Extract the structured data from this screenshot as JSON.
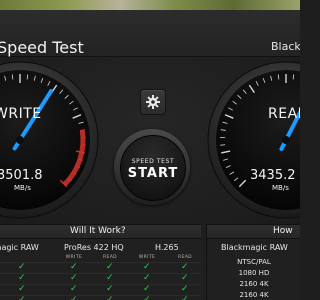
{
  "window": {
    "title": "Speed Test",
    "brand": "Blackmagic"
  },
  "gauges": {
    "write": {
      "label": "WRITE",
      "value": "3501.8",
      "unit": "MB/s",
      "fraction": 0.62
    },
    "read": {
      "label": "READ",
      "value": "3435.2",
      "unit": "MB/s",
      "fraction": 0.6
    }
  },
  "controls": {
    "settings_icon": "gear-icon",
    "start_small": "SPEED TEST",
    "start_big": "START"
  },
  "will_it_work": {
    "title": "Will It Work?",
    "formats": [
      "Blackmagic RAW",
      "ProRes 422 HQ",
      "H.265"
    ],
    "subheads": [
      "WRITE",
      "READ"
    ],
    "check_symbol": "✓",
    "check_color": "#2bd04d"
  },
  "how_fast": {
    "title": "How",
    "format": "Blackmagic RAW",
    "resolutions": [
      "NTSC/PAL",
      "1080 HD",
      "2160 4K",
      "2160 4K"
    ]
  },
  "colors": {
    "needle": "#1e9bff",
    "redzone": "#d0342c"
  }
}
